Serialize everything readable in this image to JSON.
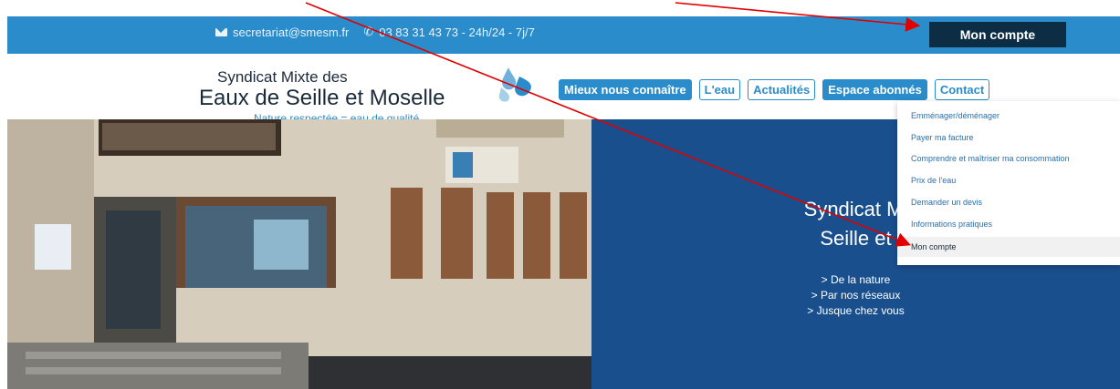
{
  "topbar": {
    "email": "secretariat@smesm.fr",
    "phone": "03 83 31 43 73 - 24h/24 - 7j/7",
    "account_button": "Mon compte",
    "color": "#2a8ccb"
  },
  "logo": {
    "line1": "Syndicat Mixte des",
    "line2": "Eaux de Seille et Moselle",
    "tagline": "Nature respectée = eau de qualité"
  },
  "nav": {
    "items": [
      {
        "label": "Mieux nous connaître",
        "active": true
      },
      {
        "label": "L'eau",
        "active": false
      },
      {
        "label": "Actualités",
        "active": false
      },
      {
        "label": "Espace abonnés",
        "active": true
      },
      {
        "label": "Contact",
        "active": false
      }
    ]
  },
  "dropdown": {
    "items": [
      "Emménager/déménager",
      "Payer ma facture",
      "Comprendre et maîtriser ma consommation",
      "Prix de l'eau",
      "Demander un devis",
      "Informations pratiques",
      "Mon compte"
    ]
  },
  "hero": {
    "title_line1": "Syndicat Mi",
    "title_line2": "Seille et",
    "lines": [
      "> De la nature",
      "> Par nos réseaux",
      "> Jusque chez vous"
    ],
    "bg_color": "#1a4f8d"
  },
  "icons": {
    "mail": "mail-icon",
    "phone": "phone-icon",
    "arrow": "red-arrow-annotation"
  }
}
